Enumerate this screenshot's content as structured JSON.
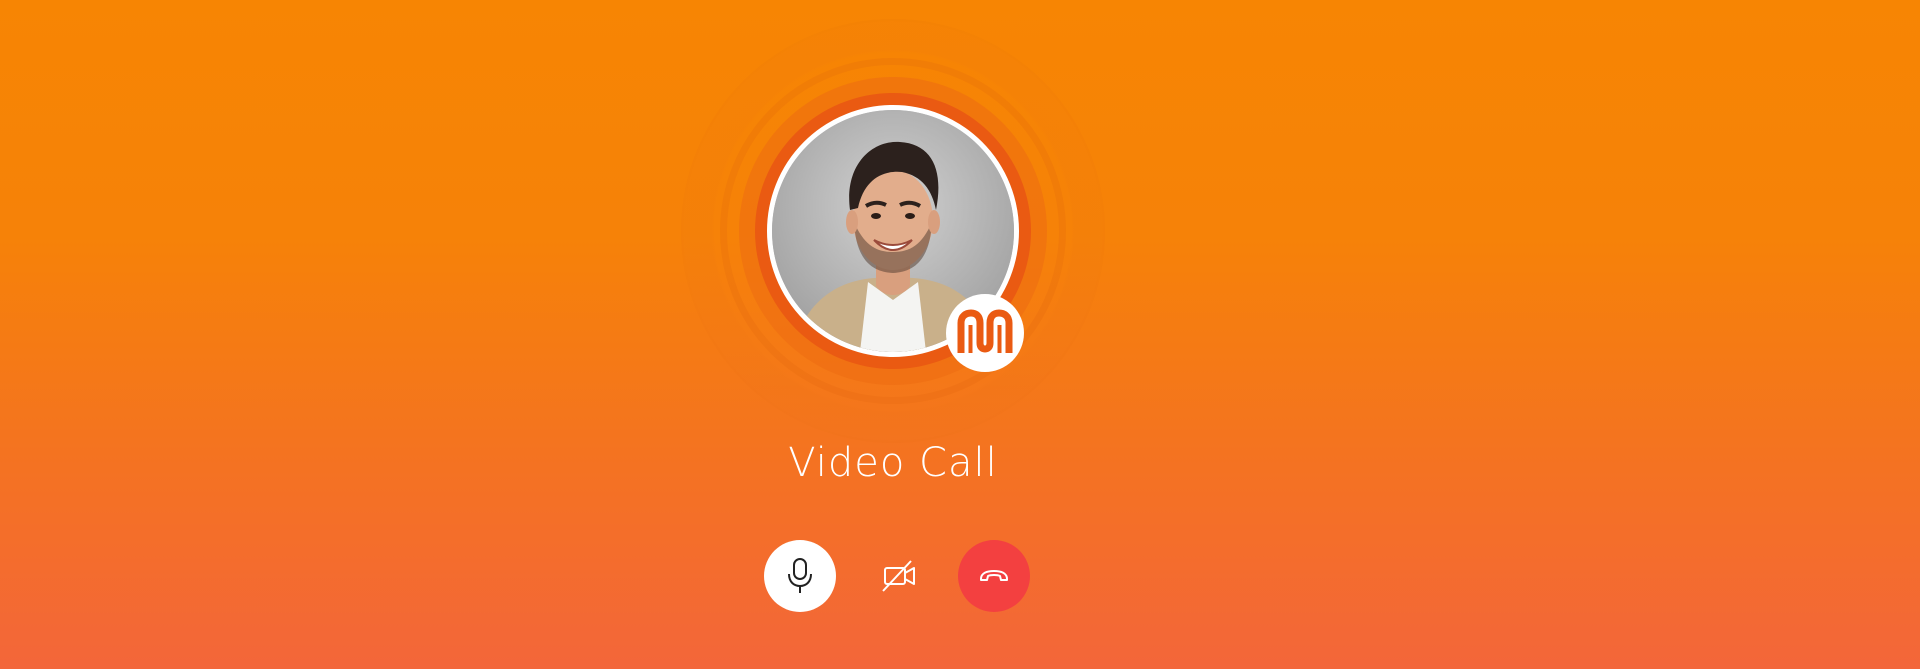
{
  "call": {
    "title": "Video Call"
  },
  "controls": {
    "mic": {
      "icon": "microphone-icon",
      "state": "on"
    },
    "video": {
      "icon": "video-off-icon",
      "state": "off"
    },
    "end": {
      "icon": "phone-hangup-icon"
    }
  },
  "colors": {
    "background_top": "#f78503",
    "background_bottom": "#f3663a",
    "ring": "#ea5a12",
    "end_call": "#f34040",
    "badge": "#ffffff",
    "badge_logo": "#ea5a12"
  },
  "badge": {
    "icon": "brand-logo-icon"
  }
}
